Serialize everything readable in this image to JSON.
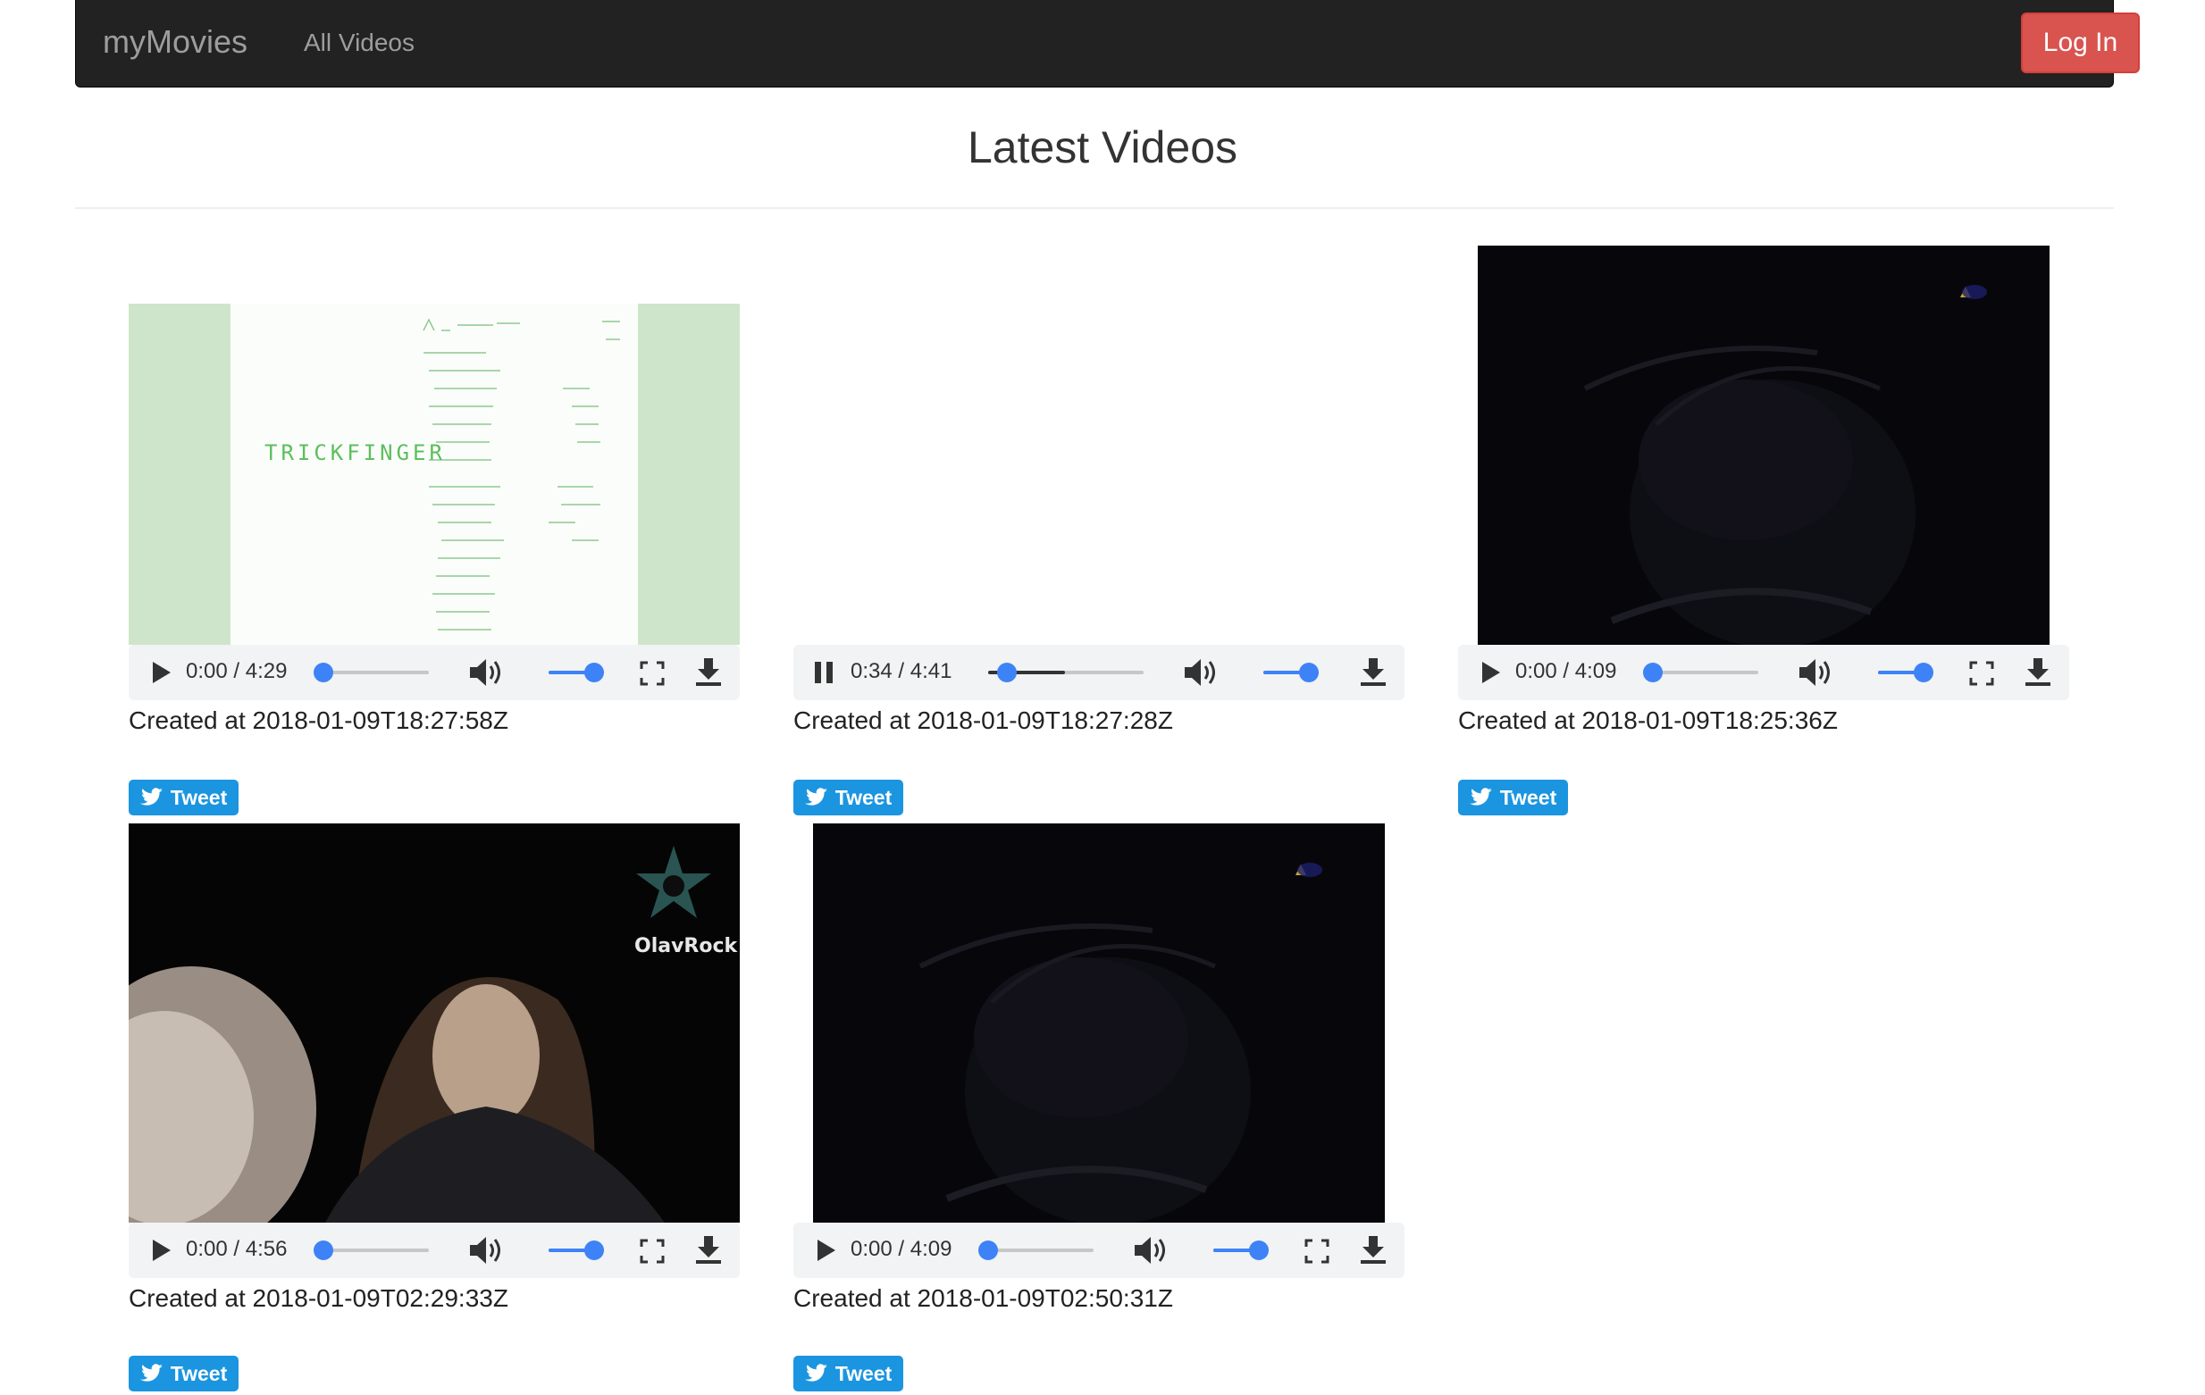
{
  "navbar": {
    "brand": "myMovies",
    "links": [
      "All Videos"
    ],
    "login_label": "Log In"
  },
  "page_title": "Latest Videos",
  "videos": [
    {
      "time": "0:00 / 4:29",
      "state": "paused",
      "progress": 0.0,
      "volume": 1.0,
      "created": "Created at 2018-01-09T18:27:58Z",
      "tweet_label": "Tweet",
      "overlay_text": "TRICKFINGER"
    },
    {
      "time": "0:34 / 4:41",
      "state": "playing",
      "progress": 0.12,
      "volume": 1.0,
      "created": "Created at 2018-01-09T18:27:28Z",
      "tweet_label": "Tweet"
    },
    {
      "time": "0:00 / 4:09",
      "state": "paused",
      "progress": 0.0,
      "volume": 1.0,
      "created": "Created at 2018-01-09T18:25:36Z",
      "tweet_label": "Tweet"
    },
    {
      "time": "0:00 / 4:56",
      "state": "paused",
      "progress": 0.0,
      "volume": 1.0,
      "created": "Created at 2018-01-09T02:29:33Z",
      "tweet_label": "Tweet",
      "overlay_text": "OlavRock"
    },
    {
      "time": "0:00 / 4:09",
      "state": "paused",
      "progress": 0.0,
      "volume": 1.0,
      "created": "Created at 2018-01-09T02:50:31Z",
      "tweet_label": "Tweet"
    }
  ],
  "colors": {
    "navbar_bg": "#222222",
    "login_bg": "#d9534f",
    "tweet_bg": "#1b95e0",
    "slider_accent": "#3e82f7"
  }
}
